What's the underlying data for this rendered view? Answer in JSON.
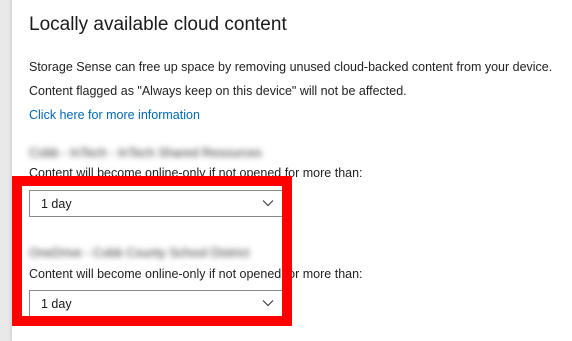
{
  "panel": {
    "title": "Locally available cloud content",
    "description_line1": "Storage Sense can free up space by removing unused cloud-backed content from your device.",
    "description_line2": "Content flagged as \"Always keep on this device\" will not be affected.",
    "info_link": "Click here for more information"
  },
  "sections": [
    {
      "account_name_blurred": "Cobb - InTech - InTech Shared Resources",
      "label": "Content will become online-only if not opened for more than:",
      "dropdown_value": "1 day"
    },
    {
      "account_name_blurred": "OneDrive - Cobb County School District",
      "label": "Content will become online-only if not opened for more than:",
      "dropdown_value": "1 day"
    }
  ],
  "icons": {
    "dropdown_chevron": "chevron-down-icon"
  },
  "colors": {
    "link": "#0067b8",
    "highlight": "#ff0000"
  }
}
